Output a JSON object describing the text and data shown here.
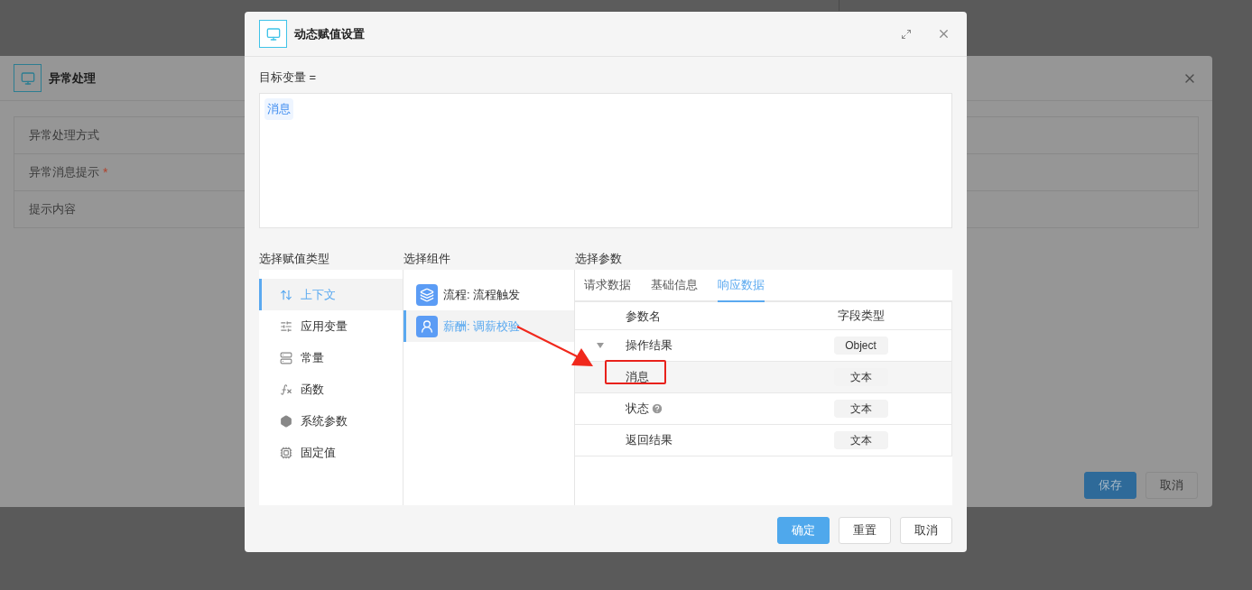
{
  "background_dialog": {
    "title": "异常处理",
    "fields": [
      {
        "label": "异常处理方式"
      },
      {
        "label": "异常消息提示",
        "required_mark": "*"
      },
      {
        "label": "提示内容"
      }
    ],
    "buttons": [
      {
        "label": "保存",
        "kind": "primary"
      },
      {
        "label": "取消",
        "kind": "default"
      }
    ]
  },
  "dialog": {
    "title": "动态赋值设置",
    "target_label": "目标变量 =",
    "target_tags": [
      "消息"
    ],
    "assign_types": {
      "title": "选择赋值类型",
      "items": [
        {
          "label": "上下文",
          "kind": "context",
          "selected": true
        },
        {
          "label": "应用变量",
          "kind": "variable",
          "selected": false
        },
        {
          "label": "常量",
          "kind": "constant",
          "selected": false
        },
        {
          "label": "函数",
          "kind": "function",
          "selected": false
        },
        {
          "label": "系统参数",
          "kind": "system",
          "selected": false
        },
        {
          "label": "固定值",
          "kind": "fixed",
          "selected": false
        }
      ]
    },
    "components": {
      "title": "选择组件",
      "items": [
        {
          "label": "流程: 流程触发",
          "kind": "flow",
          "selected": false
        },
        {
          "label": "薪酬: 调薪校验",
          "kind": "salary",
          "selected": true
        }
      ]
    },
    "params": {
      "title": "选择参数",
      "tabs": [
        {
          "label": "请求数据",
          "selected": false
        },
        {
          "label": "基础信息",
          "selected": false
        },
        {
          "label": "响应数据",
          "selected": true
        }
      ],
      "columns": [
        "参数名",
        "字段类型"
      ],
      "rows": [
        {
          "name": "操作结果",
          "type": "Object",
          "expanded": true,
          "selected": false,
          "help": false,
          "children": [
            {
              "name": "消息",
              "type": "文本",
              "selected": true,
              "help": false
            },
            {
              "name": "状态",
              "type": "文本",
              "selected": false,
              "help": true
            },
            {
              "name": "返回结果",
              "type": "文本",
              "selected": false,
              "help": false
            }
          ]
        }
      ]
    },
    "buttons": [
      {
        "label": "确定",
        "kind": "primary"
      },
      {
        "label": "重置",
        "kind": "default"
      },
      {
        "label": "取消",
        "kind": "default"
      }
    ]
  }
}
